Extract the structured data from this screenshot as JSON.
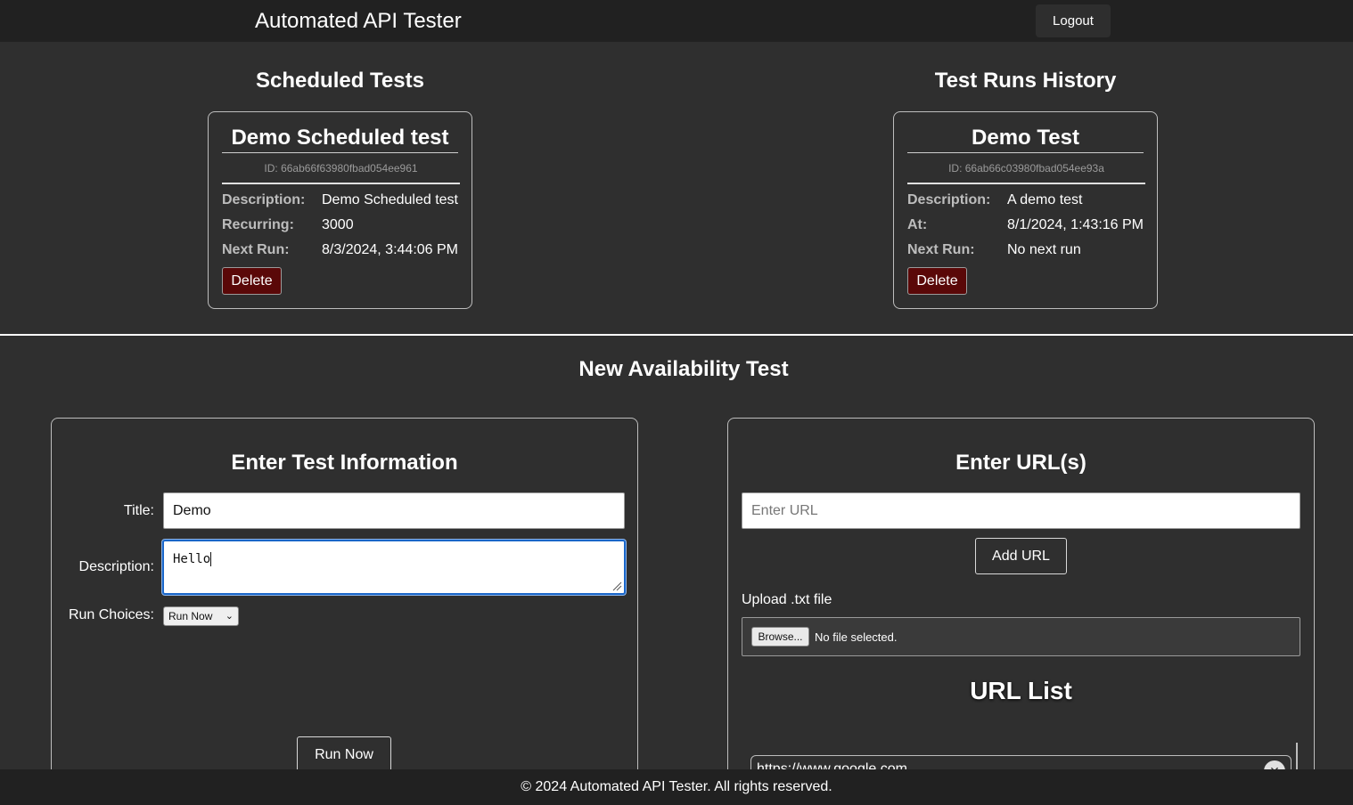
{
  "header": {
    "title": "Automated API Tester",
    "logout_label": "Logout"
  },
  "scheduled": {
    "heading": "Scheduled Tests",
    "cards": [
      {
        "title": "Demo Scheduled test",
        "id_text": "ID: 66ab66f63980fbad054ee961",
        "rows": [
          {
            "label": "Description:",
            "value": "Demo Scheduled test"
          },
          {
            "label": "Recurring:",
            "value": "3000"
          },
          {
            "label": "Next Run:",
            "value": "8/3/2024, 3:44:06 PM"
          }
        ],
        "delete_label": "Delete"
      }
    ]
  },
  "history": {
    "heading": "Test Runs History",
    "cards": [
      {
        "title": "Demo Test",
        "id_text": "ID: 66ab66c03980fbad054ee93a",
        "rows": [
          {
            "label": "Description:",
            "value": "A demo test"
          },
          {
            "label": "At:",
            "value": "8/1/2024, 1:43:16 PM"
          },
          {
            "label": "Next Run:",
            "value": "No next run"
          }
        ],
        "delete_label": "Delete"
      }
    ]
  },
  "new_test": {
    "heading": "New Availability Test",
    "info_panel": {
      "title": "Enter Test Information",
      "title_label": "Title:",
      "title_value": "Demo",
      "description_label": "Description:",
      "description_value": "Hello",
      "run_choices_label": "Run Choices:",
      "run_choice_selected": "Run Now",
      "run_button_label": "Run Now"
    },
    "url_panel": {
      "title": "Enter URL(s)",
      "url_placeholder": "Enter URL",
      "add_url_label": "Add URL",
      "upload_label": "Upload .txt file",
      "browse_label": "Browse...",
      "file_status": "No file selected.",
      "list_title": "URL List",
      "urls": [
        "https://www.google.com"
      ]
    }
  },
  "footer": {
    "text": "© 2024 Automated API Tester. All rights reserved."
  }
}
